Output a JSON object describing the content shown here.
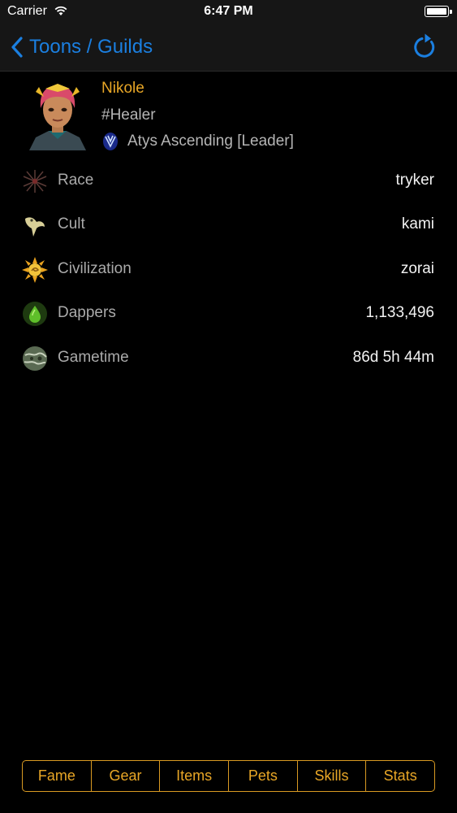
{
  "status_bar": {
    "carrier": "Carrier",
    "time": "6:47 PM"
  },
  "nav": {
    "back_label": "Toons / Guilds",
    "accent_color": "#1b7fe0",
    "refresh_icon": "refresh-icon"
  },
  "profile": {
    "name": "Nikole",
    "class": "#Healer",
    "guild": "Atys Ascending [Leader]",
    "name_color": "#e8a626"
  },
  "attributes": [
    {
      "label": "Race",
      "value": "tryker",
      "icon": "race-icon"
    },
    {
      "label": "Cult",
      "value": "kami",
      "icon": "cult-icon"
    },
    {
      "label": "Civilization",
      "value": "zorai",
      "icon": "civilization-icon"
    },
    {
      "label": "Dappers",
      "value": "1,133,496",
      "icon": "dappers-icon"
    },
    {
      "label": "Gametime",
      "value": "86d 5h 44m",
      "icon": "gametime-icon"
    }
  ],
  "tabs": [
    {
      "label": "Fame"
    },
    {
      "label": "Gear"
    },
    {
      "label": "Items"
    },
    {
      "label": "Pets"
    },
    {
      "label": "Skills"
    },
    {
      "label": "Stats"
    }
  ],
  "tab_color": "#d99a22"
}
